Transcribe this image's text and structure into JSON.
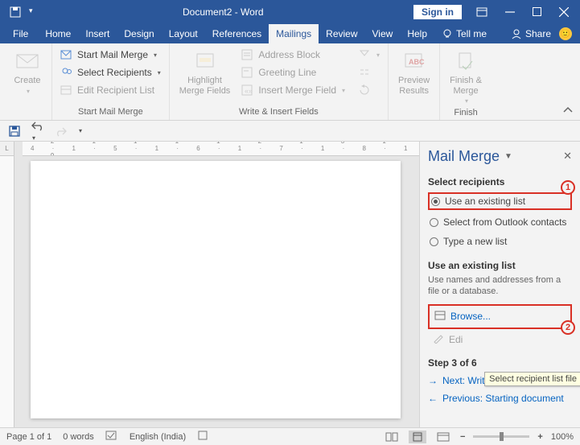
{
  "titlebar": {
    "title": "Document2 - Word",
    "signin": "Sign in"
  },
  "tabs": {
    "file": "File",
    "home": "Home",
    "insert": "Insert",
    "design": "Design",
    "layout": "Layout",
    "references": "References",
    "mailings": "Mailings",
    "review": "Review",
    "view": "View",
    "help": "Help",
    "tellme": "Tell me",
    "share": "Share"
  },
  "ribbon": {
    "create": "Create",
    "startMailMerge": "Start Mail Merge",
    "selectRecipients": "Select Recipients",
    "editRecipientList": "Edit Recipient List",
    "group1": "Start Mail Merge",
    "highlightMergeFields": "Highlight\nMerge Fields",
    "addressBlock": "Address Block",
    "greetingLine": "Greeting Line",
    "insertMergeField": "Insert Merge Field",
    "group2": "Write & Insert Fields",
    "previewResults": "Preview\nResults",
    "finishMerge": "Finish &\nMerge",
    "group3": "Finish"
  },
  "taskpane": {
    "title": "Mail Merge",
    "selectRecipients": "Select recipients",
    "opt1": "Use an existing list",
    "opt2": "Select from Outlook contacts",
    "opt3": "Type a new list",
    "useExisting": "Use an existing list",
    "desc": "Use names and addresses from a file or a database.",
    "browse": "Browse...",
    "edit": "Edi",
    "step": "Step 3 of 6",
    "next": "Next: Write your letter",
    "prev": "Previous: Starting document",
    "tooltip": "Select recipient list file",
    "callout1": "1",
    "callout2": "2"
  },
  "ruler": "· 2 · 1 · 1 · 1 · 1 · 2 · 1 · 3 · 1 · 4 · 1 · 5 · 1 · 6 · 1 · 7 · 1 · 8 · 1 · 9 ·",
  "status": {
    "page": "Page 1 of 1",
    "words": "0 words",
    "lang": "English (India)",
    "zoom": "100%"
  }
}
